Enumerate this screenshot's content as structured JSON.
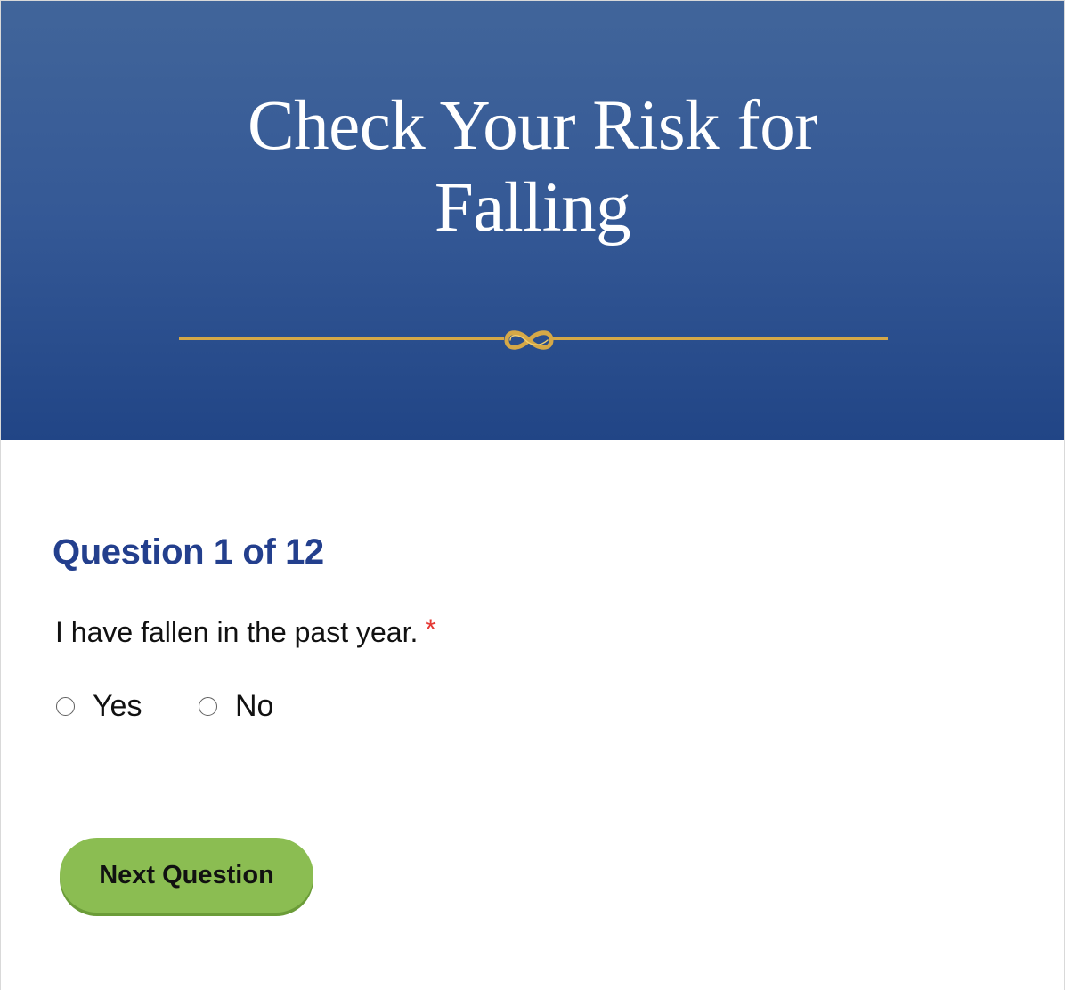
{
  "header": {
    "title": "Check Your Risk for Falling",
    "ornament_icon": "infinity-knot-icon",
    "accent_color": "#d5a847",
    "background_color": "#355996"
  },
  "question": {
    "counter": "Question 1 of 12",
    "text": "I have fallen in the past year.",
    "required_marker": "*"
  },
  "options": [
    {
      "label": "Yes",
      "selected": false,
      "icon": "radio-button-icon"
    },
    {
      "label": "No",
      "selected": false,
      "icon": "radio-button-icon"
    }
  ],
  "actions": {
    "next_label": "Next Question",
    "button_color": "#8bbd52"
  }
}
